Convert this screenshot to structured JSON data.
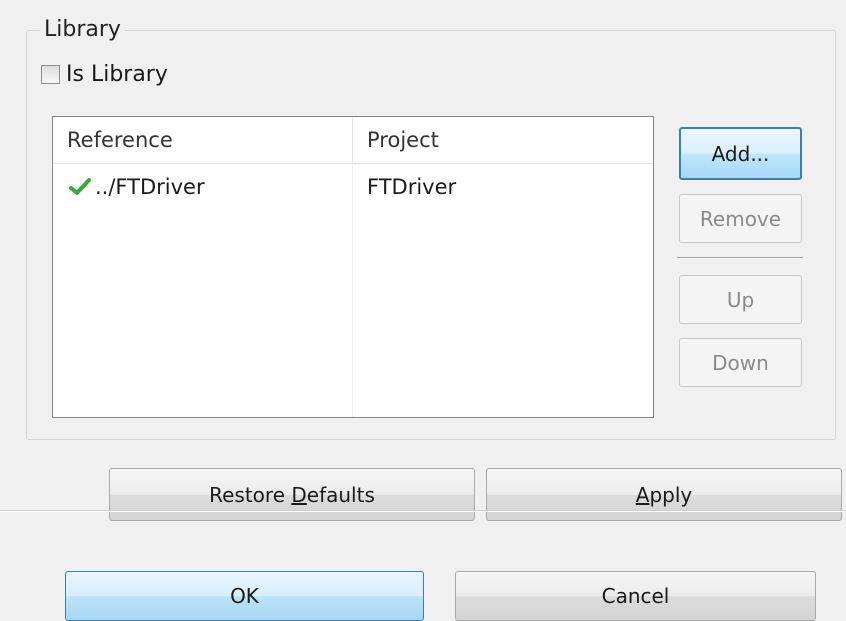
{
  "library_group": {
    "title": "Library",
    "is_library_label": "Is Library",
    "is_library_checked": false
  },
  "references_table": {
    "columns": [
      "Reference",
      "Project"
    ],
    "rows": [
      {
        "reference": "../FTDriver",
        "project": "FTDriver",
        "status_icon": "check-icon",
        "status_color": "#3aa935"
      }
    ]
  },
  "side_buttons": {
    "add": "Add...",
    "remove": "Remove",
    "up": "Up",
    "down": "Down"
  },
  "footer_buttons": {
    "restore_pre": "Restore ",
    "restore_mnemonic": "D",
    "restore_post": "efaults",
    "apply_mnemonic": "A",
    "apply_post": "pply"
  },
  "dialog_buttons": {
    "ok": "OK",
    "cancel": "Cancel"
  },
  "colors": {
    "focus_border": "#3c7fb1",
    "background": "#f0f0f0"
  }
}
